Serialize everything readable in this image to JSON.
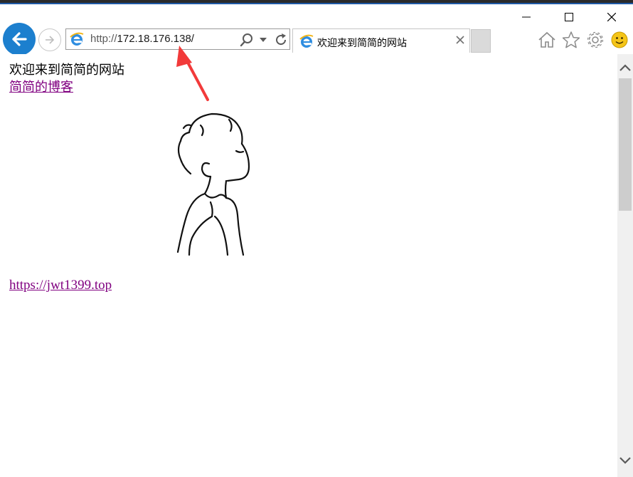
{
  "window": {
    "controls": [
      "minimize",
      "maximize",
      "close"
    ]
  },
  "toolbar": {
    "address": {
      "protocol": "http://",
      "host": "172.18.176.138/"
    },
    "tab": {
      "title": "欢迎来到简简的网站"
    },
    "icons": [
      "back-icon",
      "forward-icon",
      "ie-logo-icon",
      "search-icon",
      "chevron-down-icon",
      "refresh-icon",
      "close-icon",
      "home-icon",
      "star-icon",
      "gear-icon",
      "smiley-icon"
    ]
  },
  "page": {
    "welcome_text": "欢迎来到简简的网站",
    "blog_link": "简简的博客",
    "url_link": "https://jwt1399.top"
  },
  "colors": {
    "back_button": "#1c7fce",
    "visited_link": "#800080",
    "annotation_arrow": "#f23a3a",
    "window_frame": "#1f5aa6"
  }
}
